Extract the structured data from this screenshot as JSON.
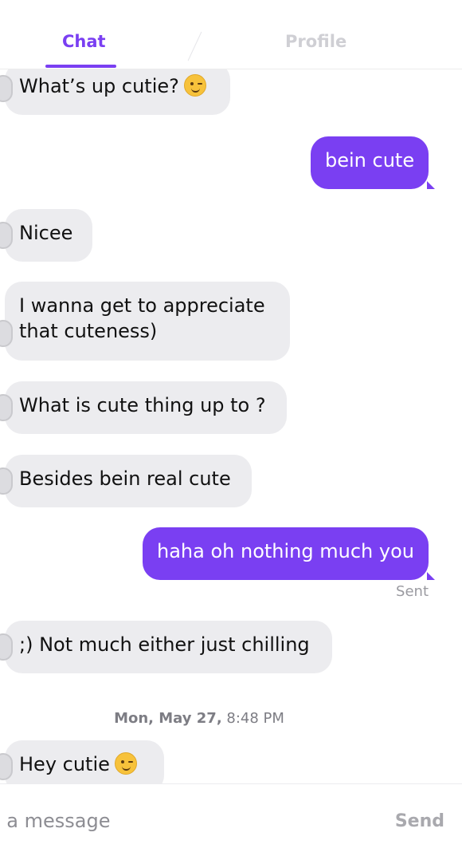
{
  "tabs": {
    "chat_label": "Chat",
    "profile_label": "Profile"
  },
  "messages": [
    {
      "side": "in",
      "text": "What’s up cutie?",
      "emoji": "wink-emoji"
    },
    {
      "side": "out",
      "text": "bein cute"
    },
    {
      "side": "in",
      "text": "Nicee"
    },
    {
      "side": "in",
      "text_line1": "I wanna get to appreciate",
      "text_line2": "that cuteness)"
    },
    {
      "side": "in",
      "text": "What is cute thing up to ?"
    },
    {
      "side": "in",
      "text": "Besides bein real cute"
    },
    {
      "side": "out",
      "text": "haha oh nothing much you",
      "status": "Sent"
    },
    {
      "side": "in",
      "text": ";) Not much either just chilling"
    },
    {
      "side": "in",
      "text": "Hey cutie",
      "emoji": "wink-emoji"
    }
  ],
  "timestamp": {
    "date": "Mon, May 27,",
    "time": "8:48 PM"
  },
  "composer": {
    "placeholder": "l a message",
    "send_label": "Send"
  },
  "colors": {
    "accent": "#7a3ff2",
    "incoming_bubble": "#ececef",
    "tab_inactive": "#cfcfd4"
  }
}
